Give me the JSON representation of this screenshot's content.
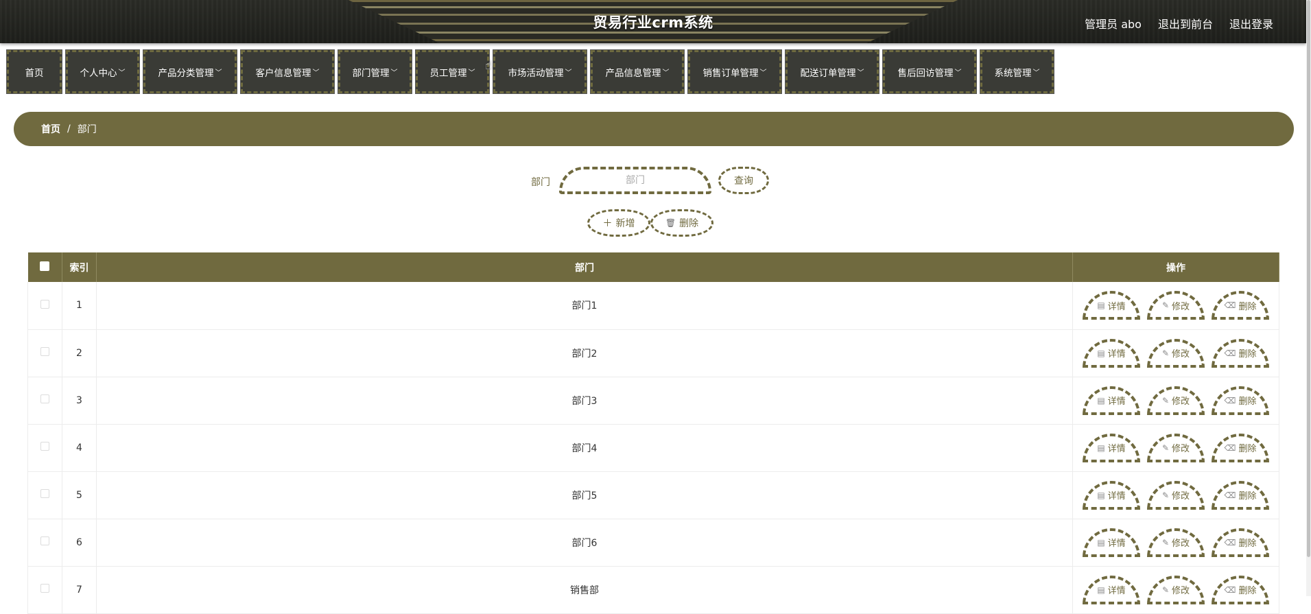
{
  "header": {
    "title": "贸易行业crm系统",
    "user_label": "管理员 abo",
    "front_link": "退出到前台",
    "logout_link": "退出登录"
  },
  "nav": {
    "items": [
      {
        "label": "首页",
        "has_dropdown": false
      },
      {
        "label": "个人中心",
        "has_dropdown": true
      },
      {
        "label": "产品分类管理",
        "has_dropdown": true
      },
      {
        "label": "客户信息管理",
        "has_dropdown": true
      },
      {
        "label": "部门管理",
        "has_dropdown": true
      },
      {
        "label": "员工管理",
        "has_dropdown": true
      },
      {
        "label": "市场活动管理",
        "has_dropdown": true
      },
      {
        "label": "产品信息管理",
        "has_dropdown": true
      },
      {
        "label": "销售订单管理",
        "has_dropdown": true
      },
      {
        "label": "配送订单管理",
        "has_dropdown": true
      },
      {
        "label": "售后回访管理",
        "has_dropdown": true
      },
      {
        "label": "系统管理",
        "has_dropdown": true
      }
    ],
    "chevron": "﹀"
  },
  "breadcrumb": {
    "home": "首页",
    "separator": "/",
    "current": "部门"
  },
  "search": {
    "label": "部门",
    "placeholder": "部门",
    "value": "",
    "query_label": "查询"
  },
  "actions": {
    "add_label": "新增",
    "add_icon": "＋",
    "delete_label": "删除",
    "delete_icon": "🗑"
  },
  "table": {
    "headers": {
      "index": "索引",
      "name": "部门",
      "ops": "操作"
    },
    "op_labels": {
      "detail": "详情",
      "edit": "修改",
      "delete": "删除"
    },
    "rows": [
      {
        "index": "1",
        "name": "部门1"
      },
      {
        "index": "2",
        "name": "部门2"
      },
      {
        "index": "3",
        "name": "部门3"
      },
      {
        "index": "4",
        "name": "部门4"
      },
      {
        "index": "5",
        "name": "部门5"
      },
      {
        "index": "6",
        "name": "部门6"
      },
      {
        "index": "7",
        "name": "销售部"
      }
    ]
  },
  "colors": {
    "accent": "#706a3f",
    "header_bg": "#1e1f1b",
    "nav_bg": "#3a3b36"
  }
}
